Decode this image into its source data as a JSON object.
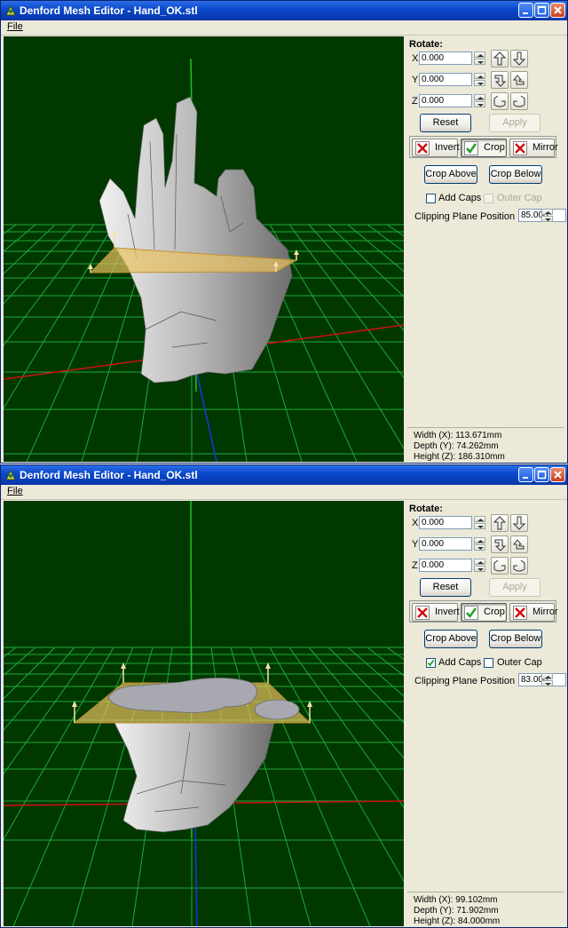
{
  "windows": [
    {
      "title": "Denford Mesh Editor - Hand_OK.stl",
      "menu": {
        "file": "File"
      },
      "panel": {
        "rotate_label": "Rotate:",
        "axes": [
          {
            "axis": "X",
            "value": "0.000"
          },
          {
            "axis": "Y",
            "value": "0.000"
          },
          {
            "axis": "Z",
            "value": "0.000"
          }
        ],
        "reset_label": "Reset",
        "apply_label": "Apply",
        "invert_label": "Invert",
        "crop_label": "Crop",
        "mirror_label": "Mirror",
        "crop_above_label": "Crop Above",
        "crop_below_label": "Crop Below",
        "add_caps_label": "Add Caps",
        "add_caps_checked": false,
        "outer_cap_label": "Outer Cap",
        "outer_cap_enabled": false,
        "clipping_label": "Clipping Plane Position",
        "clipping_value": "85.000",
        "width": "Width (X): 113.671mm",
        "depth": "Depth (Y): 74.262mm",
        "height": "Height (Z): 186.310mm"
      }
    },
    {
      "title": "Denford Mesh Editor - Hand_OK.stl",
      "menu": {
        "file": "File"
      },
      "panel": {
        "rotate_label": "Rotate:",
        "axes": [
          {
            "axis": "X",
            "value": "0.000"
          },
          {
            "axis": "Y",
            "value": "0.000"
          },
          {
            "axis": "Z",
            "value": "0.000"
          }
        ],
        "reset_label": "Reset",
        "apply_label": "Apply",
        "invert_label": "Invert",
        "crop_label": "Crop",
        "mirror_label": "Mirror",
        "crop_above_label": "Crop Above",
        "crop_below_label": "Crop Below",
        "add_caps_label": "Add Caps",
        "add_caps_checked": true,
        "outer_cap_label": "Outer Cap",
        "outer_cap_enabled": true,
        "clipping_label": "Clipping Plane Position",
        "clipping_value": "83.000",
        "width": "Width (X): 99.102mm",
        "depth": "Depth (Y): 71.902mm",
        "height": "Height (Z): 84.000mm"
      }
    }
  ],
  "colors": {
    "viewport_bg": "#003800",
    "grid": "#1fa83a",
    "axis_x": "#d01010",
    "axis_y": "#20c020",
    "axis_z": "#1838e0",
    "plane": "#e8c060",
    "mesh": "#c8c8c8"
  }
}
